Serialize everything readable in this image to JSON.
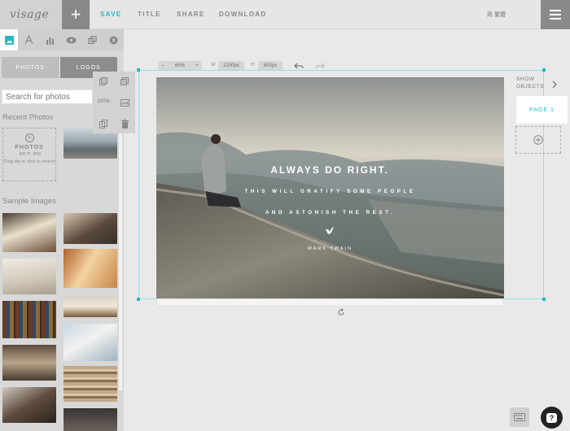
{
  "app": {
    "logo_text": "visage"
  },
  "topbar": {
    "add_label": "+",
    "save": "SAVE",
    "title": "TITLE",
    "share": "SHARE",
    "download": "DOWNLOAD",
    "language": "简 繁體"
  },
  "panel": {
    "seg_photos": "PHOTOS",
    "seg_logos": "LOGOS",
    "search_placeholder": "Search for photos",
    "recent_title": "Recent Photos",
    "dropzone_title": "PHOTOS",
    "dropzone_types": ".jpg or .png",
    "dropzone_hint": "Drag file or click to search",
    "sample_title": "Sample Images"
  },
  "tools": {
    "zoom_small": "100%"
  },
  "canvas_controls": {
    "zoom_minus": "−",
    "zoom_value": "65%",
    "zoom_plus": "+",
    "w_label": "W",
    "width_value": "1200px",
    "h_label": "H",
    "height_value": "800px"
  },
  "canvas": {
    "quote_line1": "ALWAYS DO RIGHT.",
    "quote_line2": "THIS WILL GRATIFY SOME PEOPLE",
    "quote_line3": "AND ASTONISH THE REST.",
    "author": "MARK TWAIN"
  },
  "pages": {
    "show_objects_1": "SHOW",
    "show_objects_2": "OBJECTS",
    "page1": "PAGE 1"
  },
  "help": {
    "label": "?"
  },
  "colors": {
    "accent": "#25b8c5"
  }
}
